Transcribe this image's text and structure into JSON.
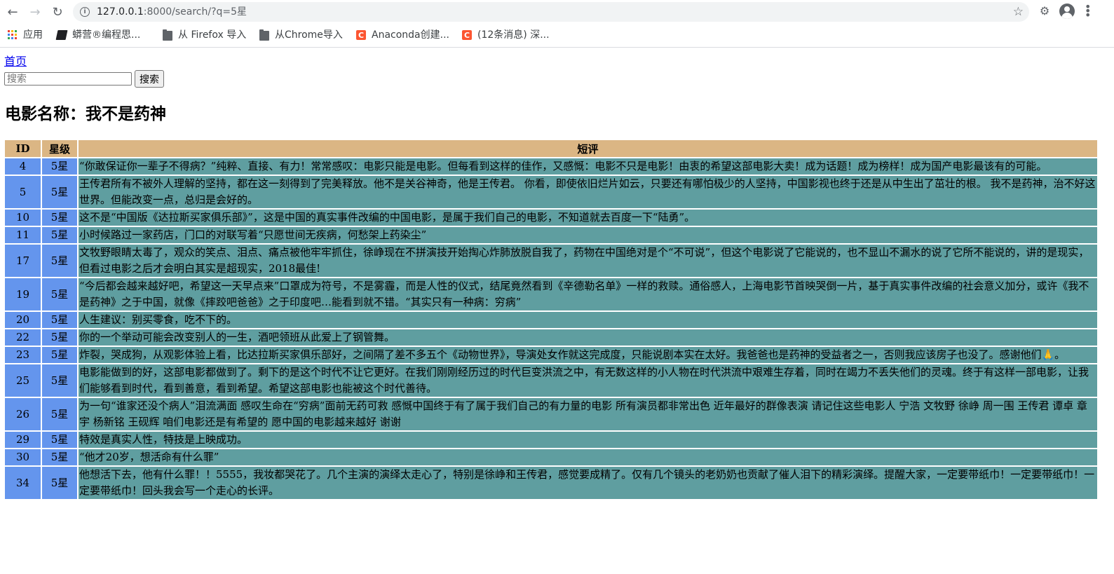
{
  "browser": {
    "url_host": "127.0.0.1",
    "url_path": ":8000/search/?q=5星",
    "bookmarks": [
      {
        "label": "应用",
        "icon": "apps-icon"
      },
      {
        "label": "蟒营®编程思...",
        "icon": "bookmark-icon"
      },
      {
        "label": "从 Firefox 导入",
        "icon": "folder-icon"
      },
      {
        "label": "从Chrome导入",
        "icon": "folder-icon"
      },
      {
        "label": "Anaconda创建...",
        "icon": "csdn-icon"
      },
      {
        "label": "(12条消息) 深...",
        "icon": "csdn-icon"
      }
    ]
  },
  "nav": {
    "home_label": "首页"
  },
  "search": {
    "placeholder": "搜索",
    "value": "",
    "button_label": "搜索"
  },
  "movie": {
    "title": "电影名称：我不是药神"
  },
  "table": {
    "headers": [
      "ID",
      "星级",
      "短评"
    ],
    "rows": [
      {
        "id": "4",
        "stars": "5星",
        "comment": "“你敢保证你一辈子不得病？”纯粹、直接、有力！常常感叹：电影只能是电影。但每看到这样的佳作，又感慨：电影不只是电影！由衷的希望这部电影大卖！成为话题！成为榜样！成为国产电影最该有的可能。"
      },
      {
        "id": "5",
        "stars": "5星",
        "comment": "王传君所有不被外人理解的坚持，都在这一刻得到了完美释放。他不是关谷神奇，他是王传君。 你看，即使依旧烂片如云，只要还有哪怕极少的人坚持，中国影视也终于还是从中生出了茁壮的根。 我不是药神，治不好这世界。但能改变一点，总归是会好的。"
      },
      {
        "id": "10",
        "stars": "5星",
        "comment": "这不是“中国版《达拉斯买家俱乐部》”，这是中国的真实事件改编的中国电影，是属于我们自己的电影，不知道就去百度一下“陆勇”。"
      },
      {
        "id": "11",
        "stars": "5星",
        "comment": "小时候路过一家药店，门口的对联写着“只愿世间无疾病，何愁架上药染尘”"
      },
      {
        "id": "17",
        "stars": "5星",
        "comment": "文牧野眼睛太毒了，观众的笑点、泪点、痛点被他牢牢抓住，徐峥现在不拼演技开始掏心炸肺放脱自我了，药物在中国绝对是个“不可说”，但这个电影说了它能说的，也不显山不漏水的说了它所不能说的，讲的是现实，但看过电影之后才会明白其实是超现实，2018最佳!"
      },
      {
        "id": "19",
        "stars": "5星",
        "comment": "“今后都会越来越好吧，希望这一天早点来”口罩成为符号，不是雾霾，而是人性的仪式，结尾竟然看到《辛德勒名单》一样的救赎。通俗感人，上海电影节首映哭倒一片，基于真实事件改编的社会意义加分，或许《我不是药神》之于中国，就像《摔跤吧爸爸》之于印度吧…能看到就不错。“其实只有一种病：穷病”"
      },
      {
        "id": "20",
        "stars": "5星",
        "comment": "人生建议：别买零食，吃不下的。"
      },
      {
        "id": "22",
        "stars": "5星",
        "comment": "你的一个举动可能会改变别人的一生，酒吧领班从此爱上了钢管舞。"
      },
      {
        "id": "23",
        "stars": "5星",
        "comment": "炸裂，哭成狗，从观影体验上看，比达拉斯买家俱乐部好，之间隔了差不多五个《动物世界》，导演处女作就这完成度，只能说剧本实在太好。我爸爸也是药神的受益者之一，否则我应该房子也没了。感谢他们🙏。"
      },
      {
        "id": "25",
        "stars": "5星",
        "comment": "电影能做到的好，这部电影都做到了。剩下的是这个时代不让它更好。在我们刚刚经历过的时代巨变洪流之中，有无数这样的小人物在时代洪流中艰难生存着，同时在竭力不丢失他们的灵魂。终于有这样一部电影，让我们能够看到时代，看到善意，看到希望。希望这部电影也能被这个时代善待。"
      },
      {
        "id": "26",
        "stars": "5星",
        "comment": "为一句“谁家还没个病人”泪流满面 感叹生命在“穷病”面前无药可救 感慨中国终于有了属于我们自己的有力量的电影 所有演员都非常出色 近年最好的群像表演 请记住这些电影人 宁浩 文牧野 徐峥 周一围 王传君 谭卓 章宇 杨新铭 王砚辉 咱们电影还是有希望的 愿中国的电影越来越好 谢谢"
      },
      {
        "id": "29",
        "stars": "5星",
        "comment": "特效是真实人性，特技是上映成功。"
      },
      {
        "id": "30",
        "stars": "5星",
        "comment": "“他才20岁，想活命有什么罪”"
      },
      {
        "id": "34",
        "stars": "5星",
        "comment": "他想活下去，他有什么罪！！5555，我妆都哭花了。几个主演的演绎太走心了，特别是徐峥和王传君，感觉要成精了。仅有几个镜头的老奶奶也贡献了催人泪下的精彩演绎。提醒大家，一定要带纸巾！一定要带纸巾！一定要带纸巾！回头我会写一个走心的长评。"
      }
    ]
  }
}
